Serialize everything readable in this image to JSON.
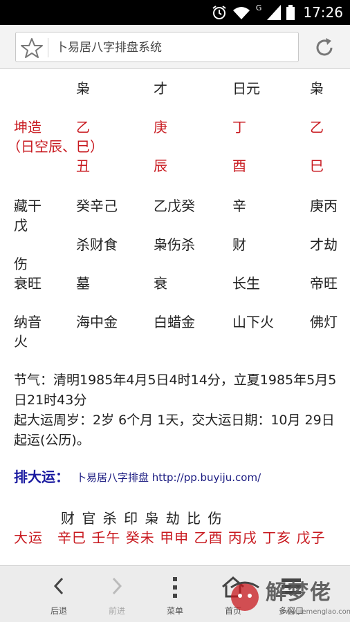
{
  "status_bar": {
    "time": "17:26",
    "network_type": "G"
  },
  "browser": {
    "page_title": "卜易居八字排盘系统",
    "icons": {
      "bookmark": "star-icon",
      "reload": "reload-icon"
    }
  },
  "chart": {
    "ten_gods_header": [
      "枭",
      "才",
      "日元",
      "枭"
    ],
    "gender_label": "坤造",
    "void_note": "（日空辰、巳）",
    "stems": [
      "乙",
      "庚",
      "丁",
      "乙"
    ],
    "branches": [
      "丑",
      "辰",
      "酉",
      "巳"
    ],
    "hidden_stems_label_1": "藏干",
    "hidden_stems_label_2": "戊",
    "hidden_stems": [
      "癸辛己",
      "乙戊癸",
      "辛",
      "庚丙"
    ],
    "hidden_gods": [
      "杀财食",
      "枭伤杀",
      "财",
      "才劫"
    ],
    "hidden_gods_tail": "伤",
    "life_stage_label": "衰旺",
    "life_stages": [
      "墓",
      "衰",
      "长生",
      "帝旺"
    ],
    "nayin_label_1": "纳音",
    "nayin_label_2": "火",
    "nayin": [
      "海中金",
      "白蜡金",
      "山下火",
      "佛灯"
    ]
  },
  "info": {
    "solar_terms": "节气：清明1985年4月5日4时14分，立夏1985年5月5日21时43分",
    "start_luck": "起大运周岁：2岁 6个月 1天，交大运日期：10月 29日起运(公历)。"
  },
  "dayun": {
    "title": "排大运：",
    "link_text": "卜易居八字排盘 http://pp.buyiju.com/",
    "gods": "财 官 杀 印 枭 劫 比 伤",
    "row": "大运　辛巳 壬午 癸未 甲申 乙酉 丙戌 丁亥 戊子"
  },
  "toolbar": {
    "back": "后退",
    "forward": "前进",
    "menu": "菜单",
    "home": "首页",
    "windows": "多窗口"
  },
  "watermark": {
    "brand": "解梦佬",
    "domain": "www.jiemenglao.com"
  },
  "colors": {
    "accent_red": "#c8191f",
    "link_blue": "#1a1aa0"
  }
}
